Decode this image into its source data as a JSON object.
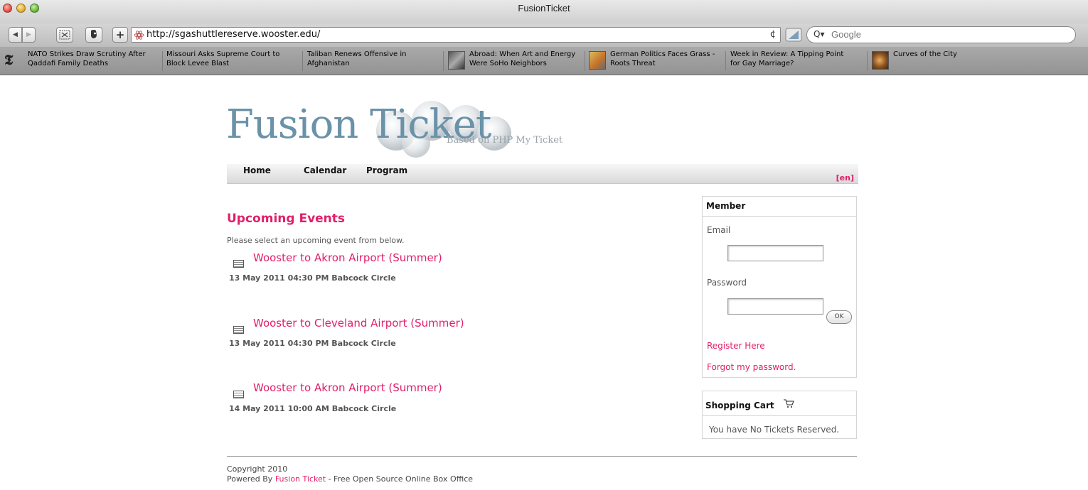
{
  "window": {
    "title": "FusionTicket"
  },
  "toolbar": {
    "back_icon": "back-arrow-icon",
    "forward_icon": "forward-arrow-icon",
    "url": "http://sgashuttlereserve.wooster.edu/",
    "reload_glyph": "¢",
    "search_placeholder": "Google",
    "search_glyph": "Q▾"
  },
  "bookmarks": [
    {
      "line1": "NATO Strikes Draw Scrutiny After",
      "line2": "Qaddafi Family Deaths"
    },
    {
      "line1": "Missouri Asks Supreme Court to",
      "line2": "Block Levee Blast"
    },
    {
      "line1": "Taliban Renews Offensive in",
      "line2": "Afghanistan"
    },
    {
      "line1": "Abroad: When Art and Energy",
      "line2": "Were SoHo Neighbors"
    },
    {
      "line1": "German Politics Faces Grass -",
      "line2": "Roots Threat"
    },
    {
      "line1": "Week in Review: A Tipping Point",
      "line2": "for Gay Marriage?"
    },
    {
      "line1": "Curves of the City",
      "line2": ""
    }
  ],
  "site": {
    "logo": "Fusion Ticket",
    "tagline": "Based on PHP My Ticket",
    "nav": [
      "Home",
      "Calendar",
      "Program"
    ],
    "language": "[en]"
  },
  "main": {
    "title": "Upcoming Events",
    "intro": "Please select an upcoming event from below.",
    "events": [
      {
        "name": "Wooster to Akron Airport (Summer)",
        "meta": "13 May 2011 04:30 PM Babcock Circle"
      },
      {
        "name": "Wooster to Cleveland Airport (Summer)",
        "meta": "13 May 2011 04:30 PM Babcock Circle"
      },
      {
        "name": "Wooster to Akron Airport (Summer)",
        "meta": "14 May 2011 10:00 AM Babcock Circle"
      }
    ]
  },
  "member": {
    "heading": "Member",
    "email_label": "Email",
    "email_value": "",
    "password_label": "Password",
    "password_value": "",
    "ok_label": "OK",
    "register_link": "Register Here",
    "forgot_link": "Forgot my password."
  },
  "cart": {
    "heading": "Shopping Cart",
    "icon": "shopping-cart-icon",
    "message": "You have No Tickets Reserved."
  },
  "footer": {
    "copyright": "Copyright 2010",
    "powered_prefix": "Powered By ",
    "powered_link": "Fusion Ticket",
    "powered_suffix": " - Free Open Source Online Box Office"
  },
  "colors": {
    "accent": "#e0206a",
    "logo": "#6a92a9"
  }
}
